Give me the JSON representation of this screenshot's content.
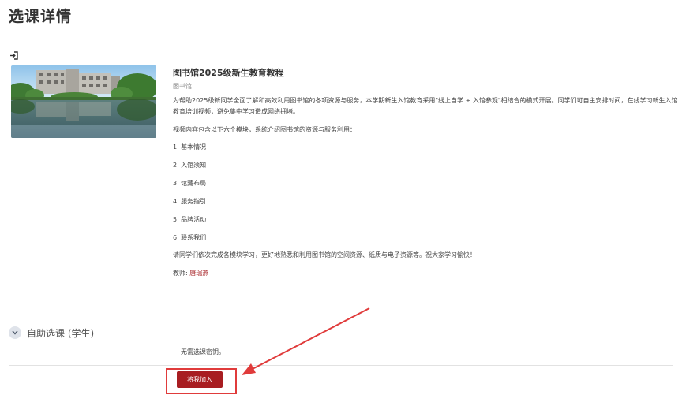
{
  "page": {
    "title": "选课详情"
  },
  "course": {
    "title": "图书馆2025级新生教育教程",
    "category": "图书馆",
    "summary": "为帮助2025级新同学全面了解和高效利用图书馆的各项资源与服务，本学期新生入馆教育采用\"线上自学 + 入馆参观\"相结合的模式开展。同学们可自主安排时间，在线学习新生入馆教育培训视频，避免集中学习造成网络拥堵。",
    "intro": "视频内容包含以下六个模块，系统介绍图书馆的资源与服务利用：",
    "modules": [
      "1. 基本情况",
      "2. 入馆须知",
      "3. 馆藏布局",
      "4. 服务指引",
      "5. 品牌活动",
      "6. 联系我们"
    ],
    "closing": " 请同学们依次完成各模块学习，更好地熟悉和利用图书馆的空间资源、纸质与电子资源等。祝大家学习愉快！",
    "teacher_label": "教师: ",
    "teacher_name": "唐瑞燕"
  },
  "enrolment": {
    "section_title": "自助选课 (学生)",
    "note": "无需选课密钥。",
    "button_label": "将我加入"
  },
  "colors": {
    "accent": "#a81d21",
    "annotation": "#e03b3b",
    "teacher_link": "#a8262a"
  },
  "icons": {
    "enter": "sign-in-icon",
    "toggle": "chevron-down-icon"
  }
}
